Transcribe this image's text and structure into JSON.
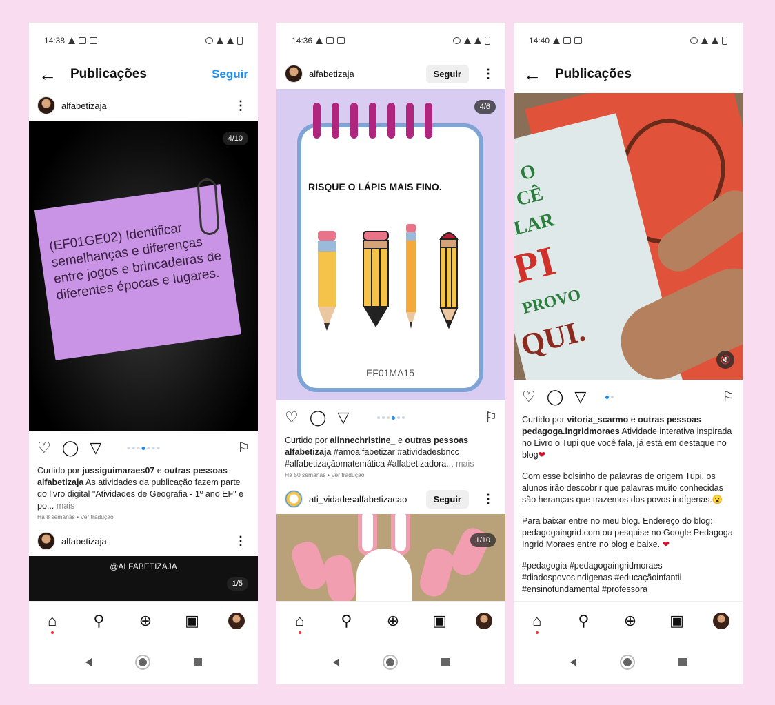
{
  "phones": [
    {
      "status": {
        "time": "14:38"
      },
      "appbar": {
        "title": "Publicações",
        "follow": "Seguir"
      },
      "post1": {
        "user": "alfabetizaja",
        "counter": "4/10",
        "slide_text": "(EF01GE02) Identificar semelhanças e diferenças entre jogos e brincadeiras de diferentes épocas e lugares.",
        "liked_prefix": "Curtido por ",
        "liked_user": "jussiguimaraes07",
        "liked_mid": " e ",
        "liked_others": "outras pessoas",
        "caption_user": "alfabetizaja",
        "caption_text": " As atividades da publicação fazem parte do livro digital \"Atividades de Geografia - 1º ano EF\" e po... ",
        "more": "mais",
        "meta": "Há 8 semanas • Ver tradução"
      },
      "post2": {
        "user": "alfabetizaja",
        "tag": "@ALFABETIZAJA",
        "counter": "1/5"
      }
    },
    {
      "status": {
        "time": "14:36"
      },
      "post1": {
        "user": "alfabetizaja",
        "follow": "Seguir",
        "counter": "4/6",
        "card_title": "RISQUE O LÁPIS MAIS FINO.",
        "card_code": "EF01MA15",
        "liked_prefix": "Curtido por ",
        "liked_user": "alinnechristine_",
        "liked_mid": " e ",
        "liked_others": "outras pessoas",
        "caption_user": "alfabetizaja",
        "caption_text": " #amoalfabetizar #atividadesbncc #alfabetizaçãomatemática #alfabetizadora... ",
        "more": "mais",
        "meta": "Há 50 semanas • Ver tradução"
      },
      "post2": {
        "user": "ati_vidadesalfabetizacao",
        "follow": "Seguir",
        "counter": "1/10"
      }
    },
    {
      "status": {
        "time": "14:40"
      },
      "appbar": {
        "title": "Publicações"
      },
      "post1": {
        "liked_prefix": "Curtido por ",
        "liked_user": "vitoria_scarmo",
        "liked_mid": " e ",
        "liked_others": "outras pessoas",
        "caption_user": "pedagoga.ingridmoraes",
        "caption_text": " Atividade interativa inspirada no Livro o Tupi que você fala, já está em destaque no blog",
        "para2": "Com esse bolsinho de palavras de origem Tupi, os alunos irão descobrir que palavras muito conhecidas são heranças que trazemos dos povos indígenas.",
        "para3": "Para baixar entre no meu blog. Endereço do blog: pedagogaingrid.com ou pesquise no Google Pedagoga Ingrid Moraes entre no blog e baixe. ",
        "hashtags": "#pedagogia #pedagogaingridmoraes #diadospovosindigenas #educaçãoinfantil #ensinofundamental #professora",
        "book_words": [
          "O",
          "CÊ",
          "LAR",
          "PI",
          "PROVO",
          "QUI."
        ]
      }
    }
  ],
  "icons": {
    "back": "←",
    "kebab": "⋮",
    "heart": "♡",
    "comment": "◯",
    "share": "▽",
    "save": "⚐",
    "home": "⌂",
    "search": "⚲",
    "add": "⊕",
    "reels": "▣",
    "mute": "🔇",
    "heart_emoji": "❤",
    "emoji": "😮"
  },
  "colors": {
    "background": "#fadcf0",
    "accent": "#1d8cf0",
    "sticky": "#c993e6",
    "spiral": "#b0257d",
    "card_border": "#7ea4d6"
  }
}
